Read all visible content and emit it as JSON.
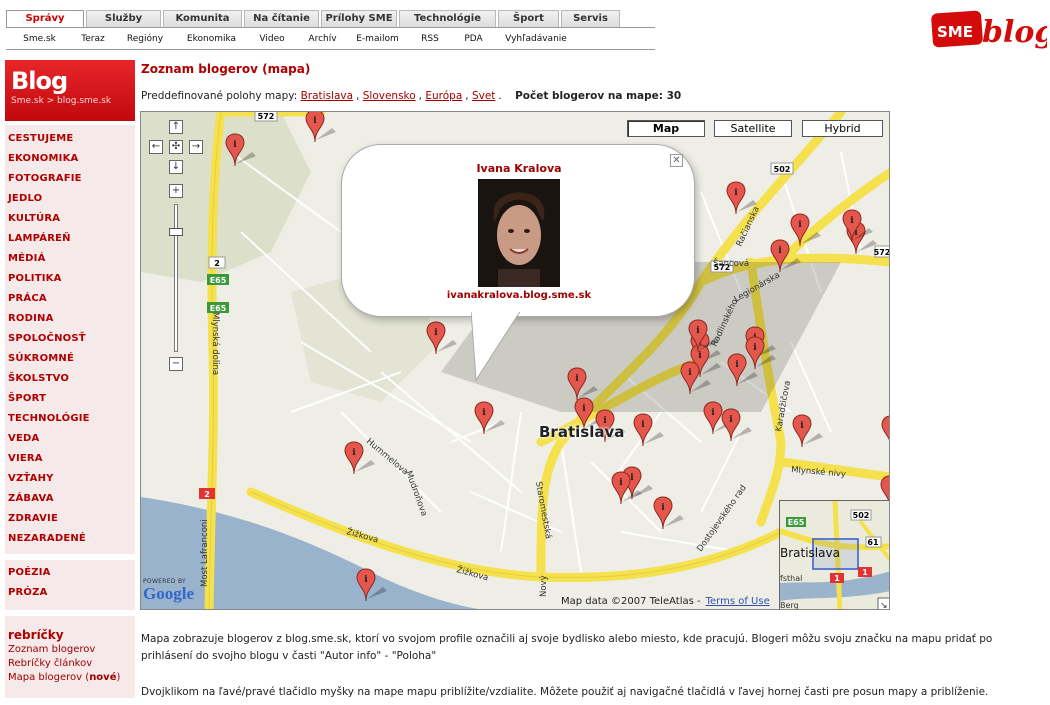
{
  "top_tabs": [
    {
      "label": "Správy",
      "active": true
    },
    {
      "label": "Služby",
      "active": false
    },
    {
      "label": "Komunita",
      "active": false
    },
    {
      "label": "Na čítanie",
      "active": false
    },
    {
      "label": "Prílohy SME",
      "active": false
    },
    {
      "label": "Technológie",
      "active": false
    },
    {
      "label": "Šport",
      "active": false
    },
    {
      "label": "Servis",
      "active": false
    }
  ],
  "sub_nav": [
    "Sme.sk",
    "Teraz",
    "Regióny",
    "Ekonomika",
    "Video",
    "Archív",
    "E-mailom",
    "RSS",
    "PDA",
    "Vyhľadávanie"
  ],
  "logo": {
    "sme": "SME",
    "blog": "blog"
  },
  "sidebar": {
    "title": "Blog",
    "breadcrumb": "Sme.sk > blog.sme.sk",
    "categories": [
      "CESTUJEME",
      "EKONOMIKA",
      "FOTOGRAFIE",
      "JEDLO",
      "KULTÚRA",
      "LAMPÁREŇ",
      "MÉDIÁ",
      "POLITIKA",
      "PRÁCA",
      "RODINA",
      "SPOLOČNOSŤ",
      "SÚKROMNÉ",
      "ŠKOLSTVO",
      "ŠPORT",
      "TECHNOLÓGIE",
      "VEDA",
      "VIERA",
      "VZŤAHY",
      "ZÁBAVA",
      "ZDRAVIE",
      "NEZARADENÉ"
    ],
    "categories2": [
      "POÉZIA",
      "PRÓZA"
    ],
    "rebricky": {
      "heading": "rebríčky",
      "links": [
        "Zoznam blogerov",
        "Rebríčky článkov",
        "Mapa blogerov"
      ],
      "new_label": "nové"
    }
  },
  "main": {
    "title": "Zoznam blogerov (mapa)",
    "presets_label": "Preddefinované polohy mapy:",
    "presets": [
      "Bratislava",
      "Slovensko",
      "Európa",
      "Svet"
    ],
    "count_label": "Počet blogerov na mape: 30",
    "desc1": "Mapa zobrazuje blogerov z blog.sme.sk, ktorí vo svojom profile označili aj svoje bydlisko alebo miesto, kde pracujú. Blogeri môžu svoju značku na mapu pridať po prihlásení do svojho blogu v časti \"Autor info\" - \"Poloha\"",
    "desc2": "Dvojklikom na ľavé/pravé tlačidlo myšky na mape mapu priblížite/vzdialite. Môžete použiť aj navigačné tlačidlá v ľavej hornej časti pre posun mapy a priblíženie."
  },
  "map": {
    "type_buttons": [
      "Map",
      "Satellite",
      "Hybrid"
    ],
    "selected_type": "Map",
    "city": "Bratislava",
    "copyright": "Map data ©2007 TeleAtlas -",
    "terms": "Terms of Use",
    "powered_by": "POWERED BY",
    "google": "Google",
    "info_window": {
      "name": "Ivana Kralova",
      "link": "ivanakralova.blog.sme.sk"
    },
    "street_labels": [
      "Šancová",
      "Legionárska",
      "Radlinského",
      "Račianska",
      "Mlynská dolina",
      "Most Lafranconi",
      "Mlynské nivy",
      "Karadžičova",
      "Dostojevského rad",
      "Staromestská",
      "Žižkova",
      "Mudroňova",
      "Hummelova",
      "Nový"
    ],
    "road_numbers": [
      "572",
      "502",
      "61",
      "2",
      "E65",
      "E65",
      "2",
      "572",
      "572"
    ],
    "minimap_labels": [
      "Bratislava",
      "E65",
      "502",
      "61",
      "Berg",
      "fsthal",
      "1",
      "1"
    ]
  }
}
